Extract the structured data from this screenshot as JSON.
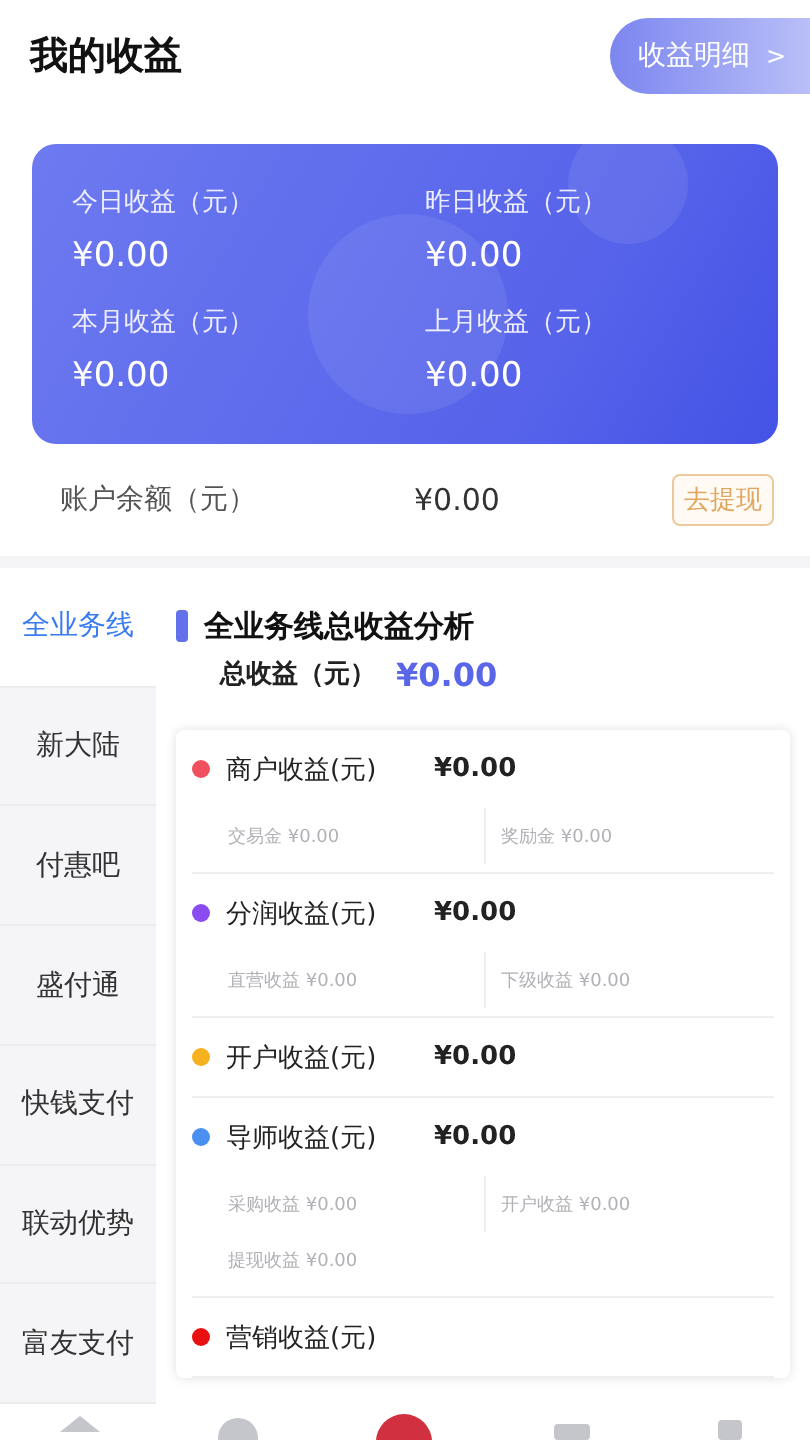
{
  "header": {
    "title": "我的收益",
    "detail_button": "收益明细",
    "detail_arrow": ">"
  },
  "summary": [
    {
      "label": "今日收益（元）",
      "value": "¥0.00"
    },
    {
      "label": "昨日收益（元）",
      "value": "¥0.00"
    },
    {
      "label": "本月收益（元）",
      "value": "¥0.00"
    },
    {
      "label": "上月收益（元）",
      "value": "¥0.00"
    }
  ],
  "balance": {
    "label": "账户余额（元）",
    "value": "¥0.00",
    "button": "去提现"
  },
  "sidebar": {
    "items": [
      {
        "label": "全业务线",
        "selected": true
      },
      {
        "label": "新大陆",
        "selected": false
      },
      {
        "label": "付惠吧",
        "selected": false
      },
      {
        "label": "盛付通",
        "selected": false
      },
      {
        "label": "快钱支付",
        "selected": false
      },
      {
        "label": "联动优势",
        "selected": false
      },
      {
        "label": "富友支付",
        "selected": false
      }
    ]
  },
  "analysis": {
    "title": "全业务线总收益分析",
    "total_label": "总收益（元）",
    "total_value": "¥0.00",
    "items": [
      {
        "label": "商户收益(元)",
        "value": "¥0.00",
        "color": "#f0505e",
        "details": [
          {
            "label": "交易金",
            "value": "¥0.00"
          },
          {
            "label": "奖励金",
            "value": "¥0.00"
          }
        ]
      },
      {
        "label": "分润收益(元)",
        "value": "¥0.00",
        "color": "#8a4cf0",
        "details": [
          {
            "label": "直营收益",
            "value": "¥0.00"
          },
          {
            "label": "下级收益",
            "value": "¥0.00"
          }
        ]
      },
      {
        "label": "开户收益(元)",
        "value": "¥0.00",
        "color": "#f5b120"
      },
      {
        "label": "导师收益(元)",
        "value": "¥0.00",
        "color": "#4a90f0",
        "details": [
          {
            "label": "采购收益",
            "value": "¥0.00"
          },
          {
            "label": "开户收益",
            "value": "¥0.00"
          },
          {
            "label": "提现收益",
            "value": "¥0.00"
          }
        ]
      },
      {
        "label": "营销收益(元)",
        "color": "#e81010"
      }
    ]
  }
}
